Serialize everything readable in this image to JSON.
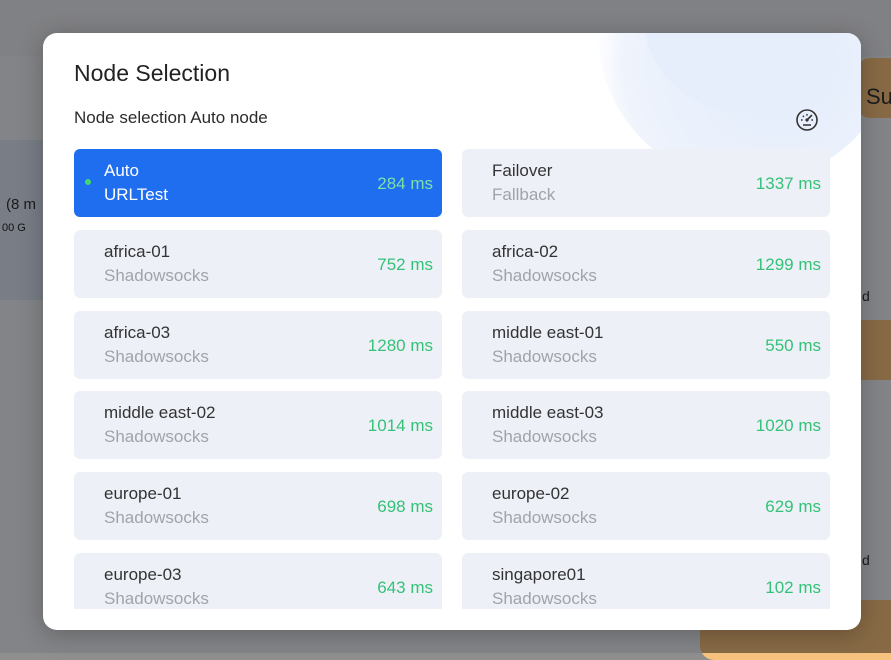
{
  "background": {
    "left_text_1": "(8 m",
    "left_text_2": "00 G",
    "right_text_1": "Su",
    "right_mark": "d"
  },
  "dialog": {
    "title": "Node Selection",
    "subtitle": "Node selection Auto node",
    "speed_test_icon": "speedometer-icon",
    "nodes": [
      {
        "name": "Auto",
        "type": "URLTest",
        "latency": "284 ms",
        "selected": true
      },
      {
        "name": "Failover",
        "type": "Fallback",
        "latency": "1337 ms",
        "selected": false
      },
      {
        "name": "africa-01",
        "type": "Shadowsocks",
        "latency": "752 ms",
        "selected": false
      },
      {
        "name": "africa-02",
        "type": "Shadowsocks",
        "latency": "1299 ms",
        "selected": false
      },
      {
        "name": "africa-03",
        "type": "Shadowsocks",
        "latency": "1280 ms",
        "selected": false
      },
      {
        "name": "middle east-01",
        "type": "Shadowsocks",
        "latency": "550 ms",
        "selected": false
      },
      {
        "name": "middle east-02",
        "type": "Shadowsocks",
        "latency": "1014 ms",
        "selected": false
      },
      {
        "name": "middle east-03",
        "type": "Shadowsocks",
        "latency": "1020 ms",
        "selected": false
      },
      {
        "name": "europe-01",
        "type": "Shadowsocks",
        "latency": "698 ms",
        "selected": false
      },
      {
        "name": "europe-02",
        "type": "Shadowsocks",
        "latency": "629 ms",
        "selected": false
      },
      {
        "name": "europe-03",
        "type": "Shadowsocks",
        "latency": "643 ms",
        "selected": false
      },
      {
        "name": "singapore01",
        "type": "Shadowsocks",
        "latency": "102 ms",
        "selected": false
      }
    ]
  },
  "colors": {
    "selected_bg": "#1f6ef0",
    "card_bg": "#edf1f7",
    "latency_green": "#35c178"
  }
}
